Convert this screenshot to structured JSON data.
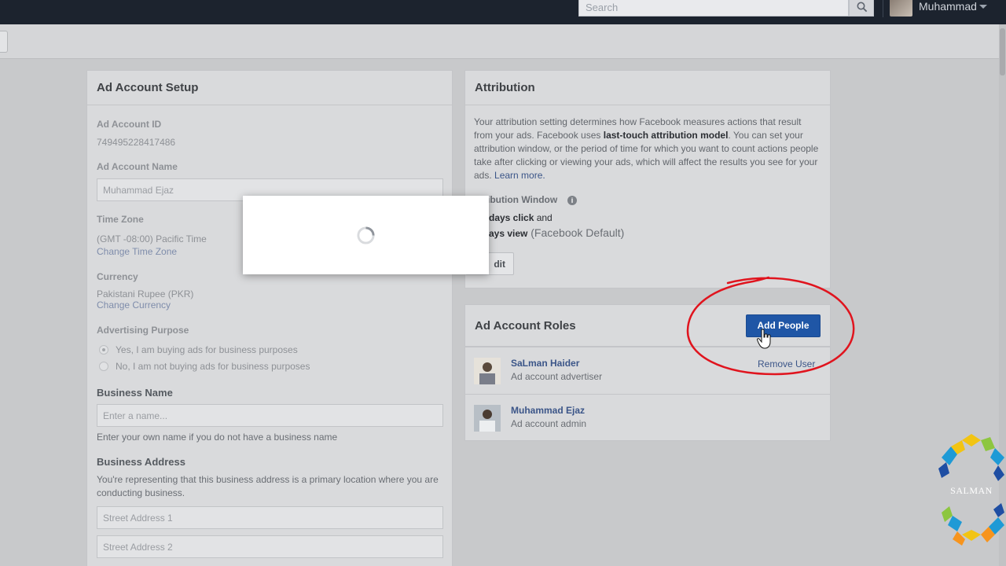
{
  "topbar": {
    "search_placeholder": "Search",
    "user_name": "Muhammad"
  },
  "setup": {
    "title": "Ad Account Setup",
    "account_id_label": "Ad Account ID",
    "account_id_value": "749495228417486",
    "account_name_label": "Ad Account Name",
    "account_name_value": "Muhammad Ejaz",
    "time_zone_label": "Time Zone",
    "time_zone_value": "(GMT -08:00) Pacific Time",
    "change_time_zone": "Change Time Zone",
    "currency_label": "Currency",
    "currency_value": "Pakistani Rupee (PKR)",
    "change_currency": "Change Currency",
    "purpose_label": "Advertising Purpose",
    "purpose_yes": "Yes, I am buying ads for business purposes",
    "purpose_no": "No, I am not buying ads for business purposes",
    "business_name_label": "Business Name",
    "business_name_placeholder": "Enter a name...",
    "business_name_help": "Enter your own name if you do not have a business name",
    "business_address_label": "Business Address",
    "business_address_help": "You're representing that this business address is a primary location where you are conducting business.",
    "street1_placeholder": "Street Address 1",
    "street2_placeholder": "Street Address 2"
  },
  "attribution": {
    "title": "Attribution",
    "desc_part1": "Your attribution setting determines how Facebook measures actions that result from your ads. Facebook uses ",
    "desc_bold": "last-touch attribution model",
    "desc_part2": ". You can set your attribution window, or the period of time for which you want to count actions people take after clicking or viewing your ads, which will affect the results you see for your ads. ",
    "learn_more": "Learn more.",
    "window_label": "ibution Window",
    "click_bold": "days click",
    "click_rest": " and",
    "view_bold": "ays view",
    "view_rest": " (Facebook Default)",
    "edit_button": "dit"
  },
  "roles": {
    "title": "Ad Account Roles",
    "add_button": "Add People",
    "people": [
      {
        "name": "SaLman Haider",
        "role": "Ad account advertiser",
        "action": "Remove User"
      },
      {
        "name": "Muhammad Ejaz",
        "role": "Ad account admin"
      }
    ]
  },
  "watermark": {
    "text": "SALMAN"
  },
  "colors": {
    "accent": "#1f56a6",
    "link": "#3b5588",
    "annotation": "#e0141e",
    "topbar": "#1c232e"
  }
}
